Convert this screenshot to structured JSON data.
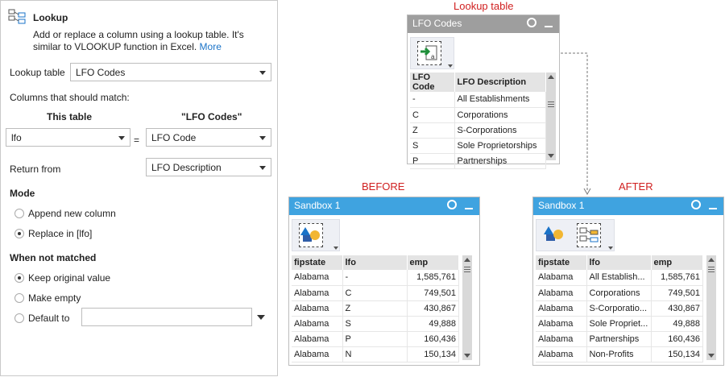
{
  "panel": {
    "title": "Lookup",
    "description": "Add or replace a column using a lookup table. It's similar to VLOOKUP function in Excel.",
    "more_link": "More",
    "lookup_table_label": "Lookup table",
    "lookup_table_value": "LFO Codes",
    "columns_match_label": "Columns that should match:",
    "this_table_header": "This table",
    "other_table_header": "\"LFO Codes\"",
    "this_column_value": "lfo",
    "equals_sign": "=",
    "other_column_value": "LFO Code",
    "return_from_label": "Return from",
    "return_from_value": "LFO Description",
    "mode_header": "Mode",
    "mode_options": [
      "Append new column",
      "Replace in [lfo]"
    ],
    "mode_selected": 1,
    "not_matched_header": "When not matched",
    "not_matched_options": [
      "Keep original value",
      "Make empty",
      "Default to"
    ],
    "not_matched_selected": 0,
    "default_value": ""
  },
  "labels": {
    "lookup_table": "Lookup table",
    "before": "BEFORE",
    "after": "AFTER"
  },
  "lookup_window": {
    "title": "LFO Codes",
    "columns": [
      "LFO Code",
      "LFO Description"
    ],
    "rows": [
      [
        "-",
        "All Establishments"
      ],
      [
        "C",
        "Corporations"
      ],
      [
        "Z",
        "S-Corporations"
      ],
      [
        "S",
        "Sole Proprietorships"
      ],
      [
        "P",
        "Partnerships"
      ]
    ]
  },
  "before_window": {
    "title": "Sandbox 1",
    "columns": [
      "fipstate",
      "lfo",
      "emp"
    ],
    "rows": [
      [
        "Alabama",
        "-",
        "1,585,761"
      ],
      [
        "Alabama",
        "C",
        "749,501"
      ],
      [
        "Alabama",
        "Z",
        "430,867"
      ],
      [
        "Alabama",
        "S",
        "49,888"
      ],
      [
        "Alabama",
        "P",
        "160,436"
      ],
      [
        "Alabama",
        "N",
        "150,134"
      ]
    ]
  },
  "after_window": {
    "title": "Sandbox 1",
    "columns": [
      "fipstate",
      "lfo",
      "emp"
    ],
    "rows": [
      [
        "Alabama",
        "All Establish...",
        "1,585,761"
      ],
      [
        "Alabama",
        "Corporations",
        "749,501"
      ],
      [
        "Alabama",
        "S-Corporatio...",
        "430,867"
      ],
      [
        "Alabama",
        "Sole Propriet...",
        "49,888"
      ],
      [
        "Alabama",
        "Partnerships",
        "160,436"
      ],
      [
        "Alabama",
        "Non-Profits",
        "150,134"
      ]
    ]
  },
  "icons": {
    "lookup": "lookup-icon",
    "search": "search-icon",
    "minimize": "minimize-icon",
    "import": "import-file-icon",
    "shapes": "shapes-icon"
  },
  "colors": {
    "accent_blue": "#3fa3e0",
    "label_red": "#d02020",
    "link": "#1a73c8"
  }
}
